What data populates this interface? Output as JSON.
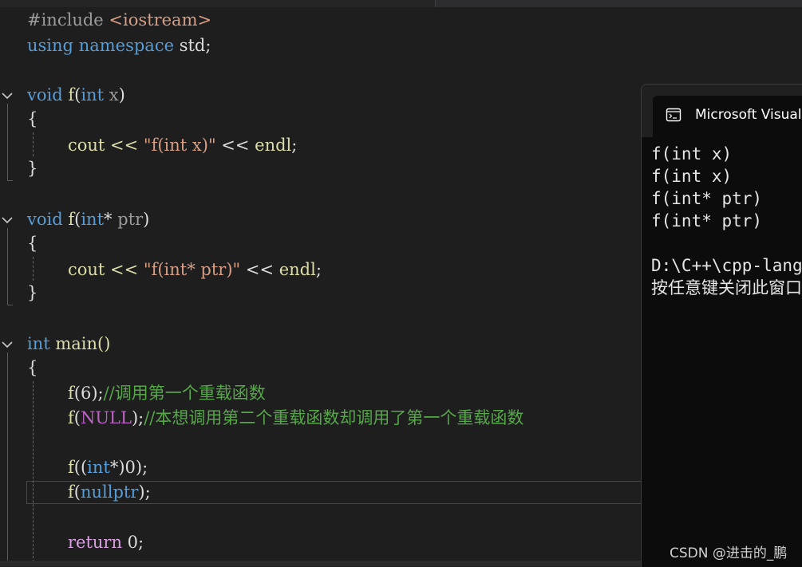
{
  "editor": {
    "include": {
      "directive": "#include",
      "path": "<iostream>"
    },
    "using": {
      "kw_using": "using",
      "kw_namespace": "namespace",
      "rest": " std;"
    },
    "func1": {
      "kw_void": "void",
      "name": "f",
      "open": "(",
      "kw_int": "int",
      "param": " x",
      "close": ")",
      "brace_open": "{",
      "brace_close": "}",
      "body_cout": "cout << ",
      "body_str": "\"f(int x)\"",
      "body_end": " << ",
      "body_endl": "endl",
      "body_semi": ";"
    },
    "func2": {
      "kw_void": "void",
      "name": "f",
      "open": "(",
      "kw_int": "int",
      "star": "*",
      "param": " ptr",
      "close": ")",
      "brace_open": "{",
      "brace_close": "}",
      "body_cout": "cout << ",
      "body_str": "\"f(int* ptr)\"",
      "body_end": " << ",
      "body_endl": "endl",
      "body_semi": ";"
    },
    "main": {
      "kw_int": "int",
      "name": " main()",
      "brace_open": "{",
      "call1": {
        "fn": "f",
        "args": "(6);",
        "comment": "//调用第一个重载函数"
      },
      "call2": {
        "fn": "f",
        "open": "(",
        "macro": "NULL",
        "close": ");",
        "comment": "//本想调用第二个重载函数却调用了第一个重载函数"
      },
      "call3": {
        "fn": "f",
        "open": "((",
        "kw_int": "int",
        "rest": "*)0);"
      },
      "call4": {
        "fn": "f",
        "open": "(",
        "kw": "nullptr",
        "close": ");"
      },
      "ret": {
        "kw": "return",
        "rest": " 0;"
      }
    }
  },
  "console": {
    "title": "Microsoft Visual Studio 调试控制台",
    "output": [
      "f(int x)",
      "f(int x)",
      "f(int* ptr)",
      "f(int* ptr)",
      "",
      "D:\\C++\\cpp-language",
      "按任意键关闭此窗口. . ."
    ]
  },
  "watermark": "CSDN @进击的_鹏"
}
